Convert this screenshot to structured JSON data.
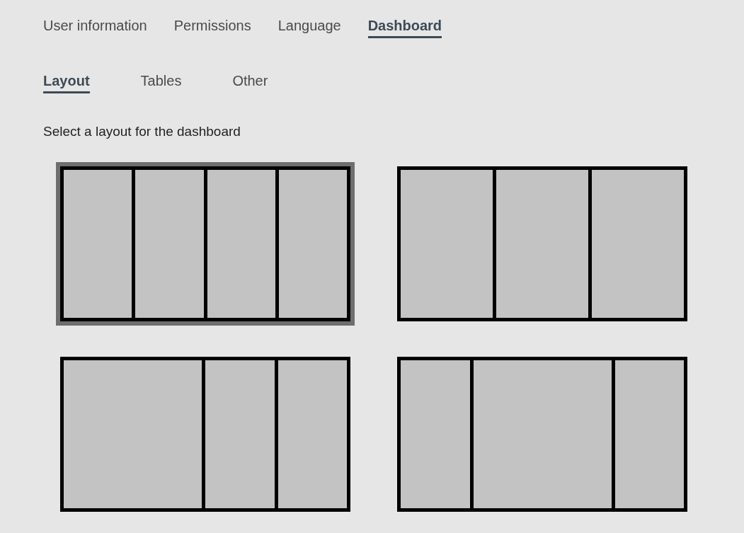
{
  "tabs": [
    {
      "label": "User information",
      "selected": false
    },
    {
      "label": "Permissions",
      "selected": false
    },
    {
      "label": "Language",
      "selected": false
    },
    {
      "label": "Dashboard",
      "selected": true
    }
  ],
  "subtabs": [
    {
      "label": "Layout",
      "selected": true
    },
    {
      "label": "Tables",
      "selected": false
    },
    {
      "label": "Other",
      "selected": false
    }
  ],
  "prompt": "Select a layout for the dashboard",
  "layouts": [
    {
      "kind": "four-equal",
      "selected": true
    },
    {
      "kind": "three-equal",
      "selected": false
    },
    {
      "kind": "wide-left",
      "selected": false
    },
    {
      "kind": "wide-center",
      "selected": false
    }
  ]
}
